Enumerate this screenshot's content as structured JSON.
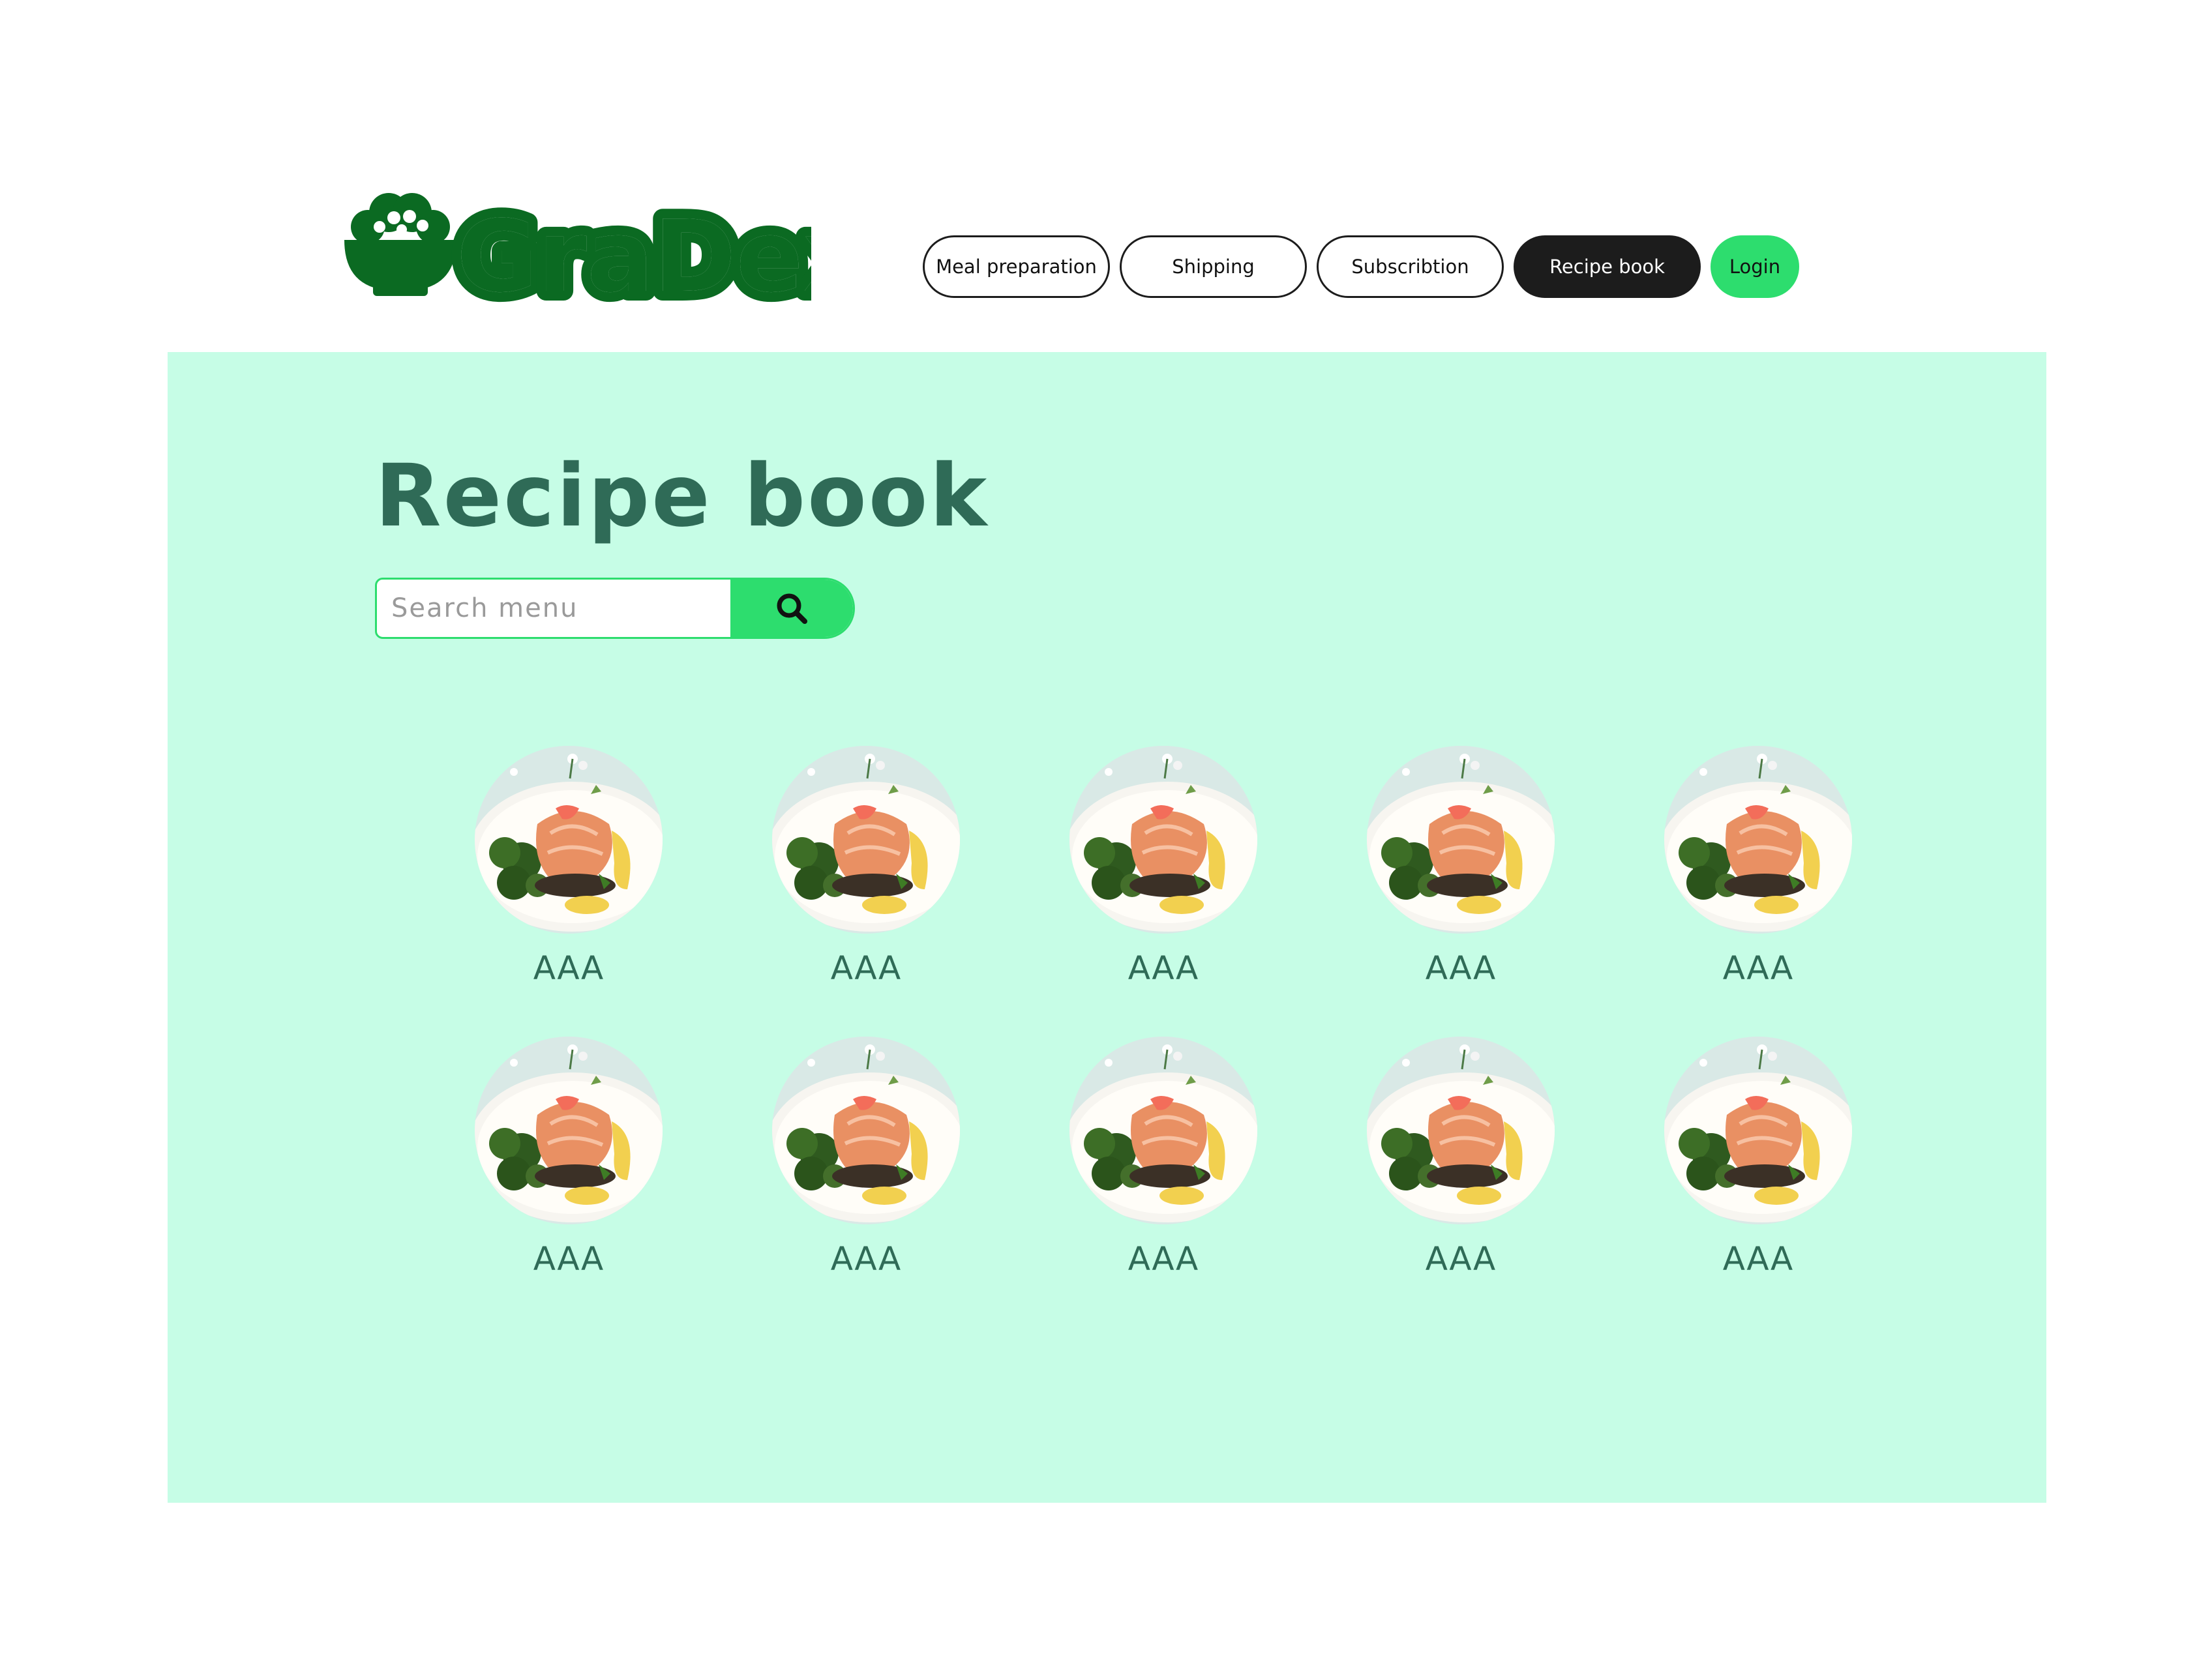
{
  "brand": {
    "name": "GraDex",
    "color": "#0b6a22"
  },
  "nav": {
    "items": [
      {
        "label": "Meal preparation",
        "active": false
      },
      {
        "label": "Shipping",
        "active": false
      },
      {
        "label": "Subscribtion",
        "active": false
      },
      {
        "label": "Recipe book",
        "active": true
      }
    ],
    "login_label": "Login",
    "login_color": "#2ddd6e"
  },
  "main": {
    "background": "#c6fde6",
    "title": "Recipe book",
    "search": {
      "placeholder": "Search menu",
      "value": "",
      "button_icon": "search-icon"
    },
    "recipes": [
      {
        "name": "AAA",
        "image": "salmon-dish"
      },
      {
        "name": "AAA",
        "image": "salmon-dish"
      },
      {
        "name": "AAA",
        "image": "salmon-dish"
      },
      {
        "name": "AAA",
        "image": "salmon-dish"
      },
      {
        "name": "AAA",
        "image": "salmon-dish"
      },
      {
        "name": "AAA",
        "image": "salmon-dish"
      },
      {
        "name": "AAA",
        "image": "salmon-dish"
      },
      {
        "name": "AAA",
        "image": "salmon-dish"
      },
      {
        "name": "AAA",
        "image": "salmon-dish"
      },
      {
        "name": "AAA",
        "image": "salmon-dish"
      }
    ]
  }
}
